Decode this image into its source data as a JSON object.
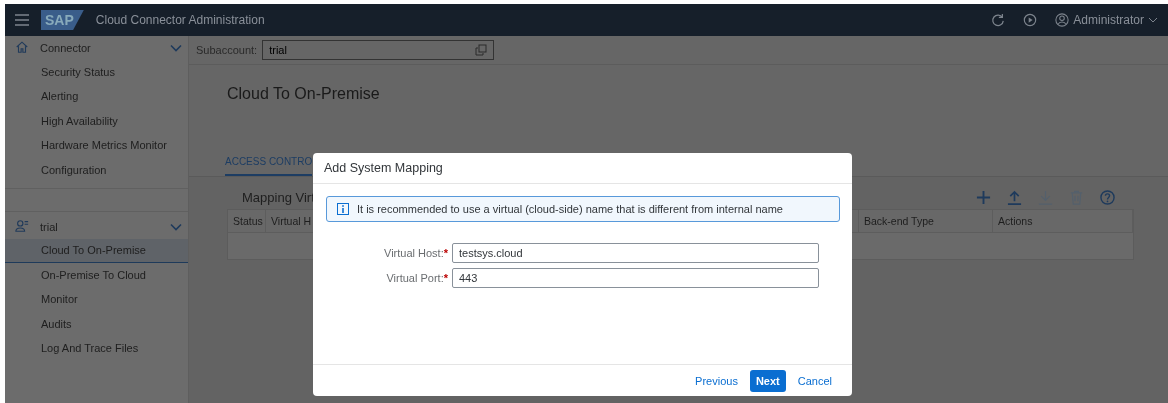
{
  "header": {
    "logo": "SAP",
    "title": "Cloud Connector Administration",
    "user": "Administrator"
  },
  "sidebar": {
    "groups": [
      {
        "label": "Connector",
        "expanded": true,
        "items": [
          {
            "label": "Security Status",
            "selected": false
          },
          {
            "label": "Alerting",
            "selected": false
          },
          {
            "label": "High Availability",
            "selected": false
          },
          {
            "label": "Hardware Metrics Monitor",
            "selected": false
          },
          {
            "label": "Configuration",
            "selected": false
          }
        ]
      },
      {
        "label": "trial",
        "expanded": true,
        "items": [
          {
            "label": "Cloud To On-Premise",
            "selected": true
          },
          {
            "label": "On-Premise To Cloud",
            "selected": false
          },
          {
            "label": "Monitor",
            "selected": false
          },
          {
            "label": "Audits",
            "selected": false
          },
          {
            "label": "Log And Trace Files",
            "selected": false
          }
        ]
      }
    ]
  },
  "subaccount": {
    "label": "Subaccount:",
    "value": "trial"
  },
  "page_title": "Cloud To On-Premise",
  "tabs": [
    {
      "label": "ACCESS CONTRO",
      "selected": true
    }
  ],
  "section": {
    "title": "Mapping Virt",
    "toolbar": [
      {
        "kind": "add",
        "disabled": false
      },
      {
        "kind": "upload",
        "disabled": false
      },
      {
        "kind": "download",
        "disabled": true
      },
      {
        "kind": "delete",
        "disabled": true
      },
      {
        "kind": "help",
        "disabled": false
      }
    ],
    "columns": [
      "Status",
      "Virtual H",
      "Back-end Type",
      "Actions"
    ]
  },
  "dialog": {
    "title": "Add System Mapping",
    "info": "It is recommended to use a virtual (cloud-side) name that is different from internal name",
    "fields": [
      {
        "label": "Virtual Host:",
        "required_mark": "*",
        "value": "testsys.cloud"
      },
      {
        "label": "Virtual Port:",
        "required_mark": "*",
        "value": "443"
      }
    ],
    "buttons": [
      {
        "label": "Previous",
        "kind": "link"
      },
      {
        "label": "Next",
        "kind": "primary"
      },
      {
        "label": "Cancel",
        "kind": "link"
      }
    ]
  }
}
